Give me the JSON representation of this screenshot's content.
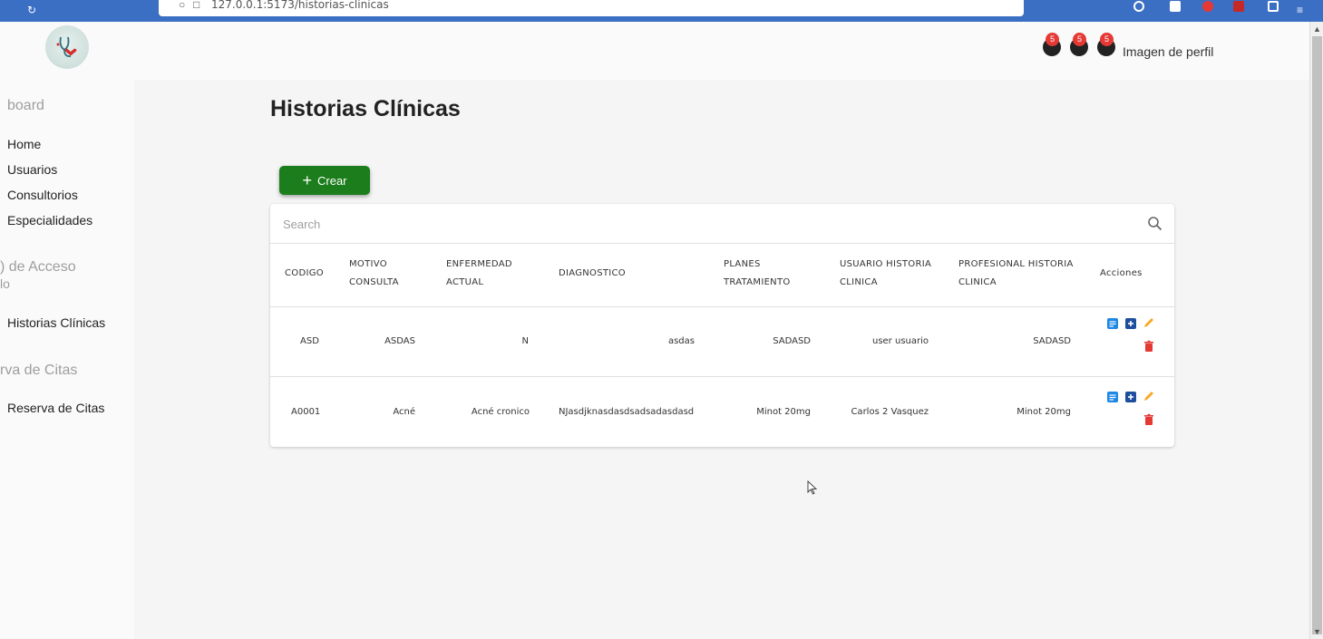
{
  "browser": {
    "url": "127.0.0.1:5173/historias-clinicas"
  },
  "header": {
    "notification_counts": [
      "5",
      "5",
      "5"
    ],
    "profile_label": "Imagen de perfil"
  },
  "sidebar": {
    "section_dashboard": "board",
    "items_main": [
      {
        "label": "Home"
      },
      {
        "label": "Usuarios"
      },
      {
        "label": "Consultorios"
      },
      {
        "label": "Especialidades"
      }
    ],
    "section_access_line1": ") de Acceso",
    "section_access_line2": "lo",
    "item_historias": "Historias Clínicas",
    "section_citas": "rva de Citas",
    "item_reserva": "Reserva de Citas"
  },
  "main": {
    "title": "Historias Clínicas",
    "create_label": "Crear",
    "search_placeholder": "Search",
    "columns": [
      {
        "l1": "CODIGO",
        "l2": ""
      },
      {
        "l1": "MOTIVO",
        "l2": "CONSULTA"
      },
      {
        "l1": "ENFERMEDAD",
        "l2": "ACTUAL"
      },
      {
        "l1": "DIAGNOSTICO",
        "l2": ""
      },
      {
        "l1": "PLANES",
        "l2": "TRATAMIENTO"
      },
      {
        "l1": "USUARIO HISTORIA",
        "l2": "CLINICA"
      },
      {
        "l1": "PROFESIONAL HISTORIA",
        "l2": "CLINICA"
      },
      {
        "l1": "Acciones",
        "l2": ""
      }
    ],
    "rows": [
      {
        "codigo": "ASD",
        "motivo": "ASDAS",
        "enfermedad": "N",
        "diagnostico": "asdas",
        "planes": "SADASD",
        "usuario": "user usuario",
        "profesional": "SADASD"
      },
      {
        "codigo": "A0001",
        "motivo": "Acné",
        "enfermedad": "Acné cronico",
        "diagnostico": "NJasdjknasdasdsadsadasdasd",
        "planes": "Minot 20mg",
        "usuario": "Carlos 2 Vasquez",
        "profesional": "Minot 20mg"
      }
    ]
  },
  "colors": {
    "accent_green": "#1b7d1b",
    "action_blue": "#1e88e5",
    "action_yellow": "#f9a825",
    "action_red": "#e53935",
    "badge_red": "#e53935",
    "browser_blue": "#3b6fc4"
  }
}
